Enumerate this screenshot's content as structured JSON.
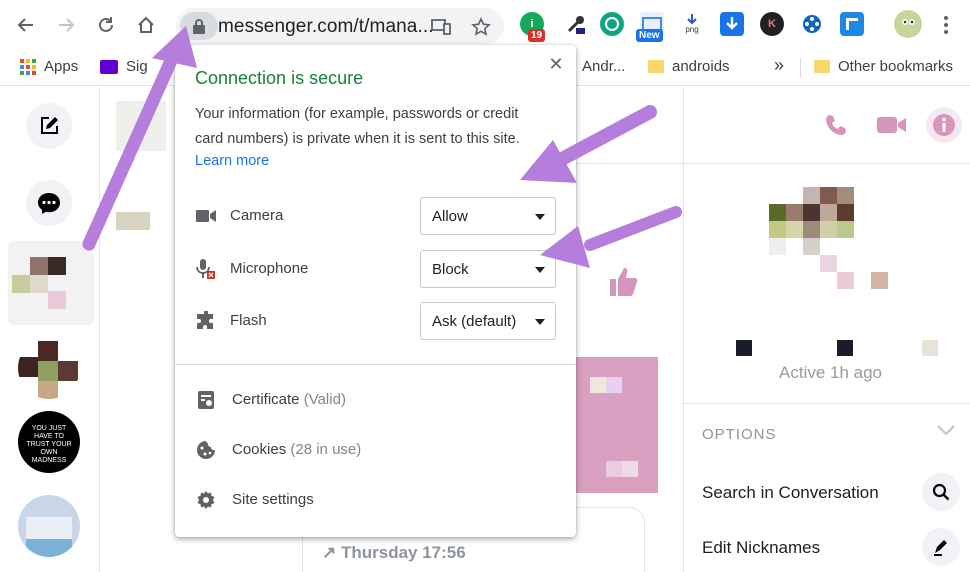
{
  "browser": {
    "url": "messenger.com/t/mana...",
    "extensions": [
      {
        "name": "grammar-extension-icon",
        "color": "#15a85a",
        "badge": "19",
        "badge_color": "#d93025"
      },
      {
        "name": "eyedropper-extension-icon",
        "color": "#ffffff"
      },
      {
        "name": "blocker-extension-icon",
        "color": "#10a37f"
      },
      {
        "name": "news-extension-icon",
        "color": "#1a73e8",
        "badge": "New",
        "badge_color": "#1a73e8"
      },
      {
        "name": "png-extension-icon",
        "color": "#2a56c6",
        "label": "png"
      },
      {
        "name": "download-extension-icon",
        "color": "#1a73e8"
      },
      {
        "name": "k-extension-icon",
        "color": "#202124",
        "label": "K"
      },
      {
        "name": "joystick-extension-icon",
        "color": "#1565c0"
      },
      {
        "name": "window-extension-icon",
        "color": "#1e88e5"
      }
    ]
  },
  "bookmarks": {
    "apps": "Apps",
    "sig": "Sig",
    "andr": "Andr...",
    "androids": "androids",
    "more": "»",
    "other": "Other bookmarks"
  },
  "popup": {
    "title": "Connection is secure",
    "description": "Your information (for example, passwords or credit card numbers) is private when it is sent to this site.",
    "learn_more": "Learn more",
    "close": "✕",
    "permissions": [
      {
        "label": "Camera",
        "value": "Allow"
      },
      {
        "label": "Microphone",
        "value": "Block"
      },
      {
        "label": "Flash",
        "value": "Ask (default)"
      }
    ],
    "certificate": {
      "label": "Certificate",
      "sub": "(Valid)"
    },
    "cookies": {
      "label": "Cookies",
      "sub": "(28 in use)"
    },
    "site_settings": "Site settings"
  },
  "messenger": {
    "active_status": "Active 1h ago",
    "options_header": "OPTIONS",
    "search_conversation": "Search in Conversation",
    "edit_nicknames": "Edit Nicknames",
    "timestamp": "↗ Thursday 17:56",
    "brand_color": "#d696bb",
    "avatar_text": "YOU JUST HAVE TO TRUST YOUR OWN MADNESS"
  },
  "colors": {
    "secure_green": "#188038",
    "link_blue": "#1a73e8",
    "arrow_purple": "#b57edc"
  }
}
